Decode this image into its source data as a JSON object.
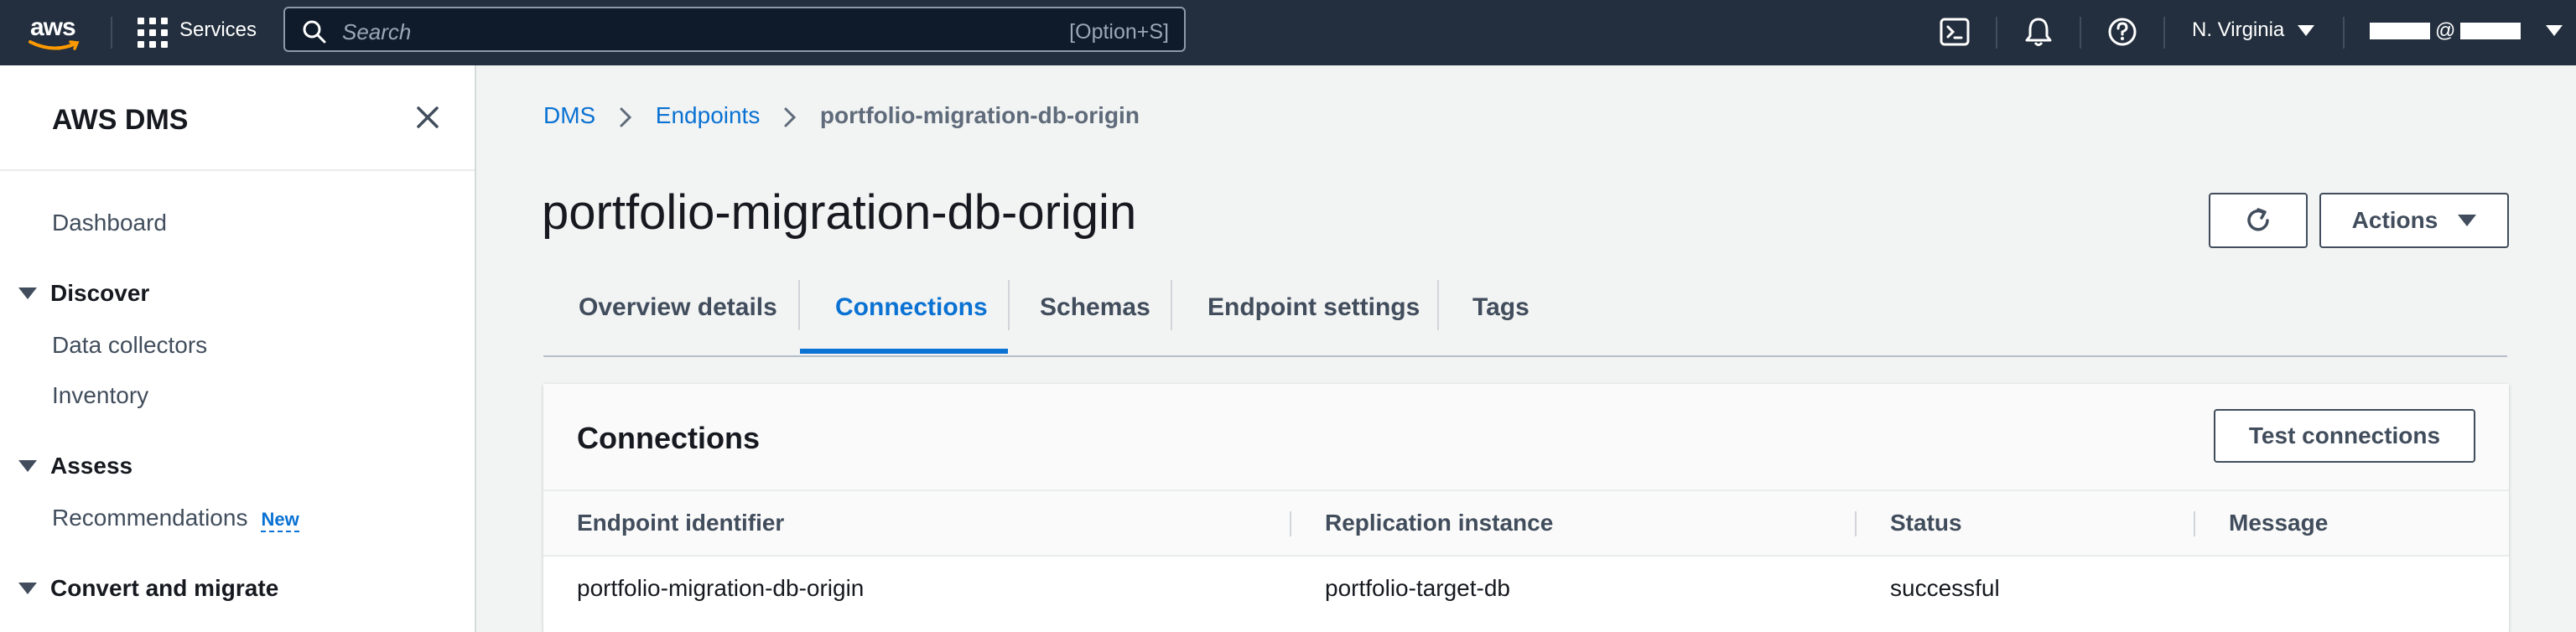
{
  "topnav": {
    "logo_text": "aws",
    "services_label": "Services",
    "search_placeholder": "Search",
    "search_shortcut": "[Option+S]",
    "region_label": "N. Virginia",
    "account_separator": "@"
  },
  "sidebar": {
    "title": "AWS DMS",
    "dashboard_label": "Dashboard",
    "sections": [
      {
        "label": "Discover",
        "items": [
          "Data collectors",
          "Inventory"
        ]
      },
      {
        "label": "Assess",
        "items": [
          "Recommendations"
        ]
      },
      {
        "label": "Convert and migrate",
        "items": []
      }
    ],
    "new_badge": "New"
  },
  "breadcrumb": {
    "items": [
      "DMS",
      "Endpoints",
      "portfolio-migration-db-origin"
    ]
  },
  "page": {
    "title": "portfolio-migration-db-origin",
    "actions_label": "Actions"
  },
  "tabs": [
    "Overview details",
    "Connections",
    "Schemas",
    "Endpoint settings",
    "Tags"
  ],
  "active_tab": "Connections",
  "connections": {
    "title": "Connections",
    "test_button": "Test connections",
    "columns": [
      "Endpoint identifier",
      "Replication instance",
      "Status",
      "Message"
    ],
    "rows": [
      {
        "endpoint": "portfolio-migration-db-origin",
        "instance": "portfolio-target-db",
        "status": "successful",
        "message": ""
      }
    ]
  },
  "colors": {
    "nav_bg": "#232f3e",
    "link": "#0972d3",
    "page_bg": "#f2f3f3"
  }
}
